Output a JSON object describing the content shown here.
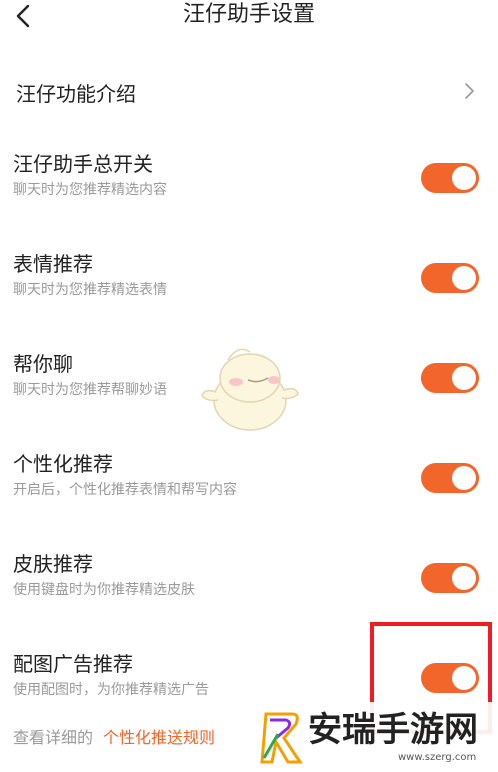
{
  "header": {
    "title": "汪仔助手设置",
    "back_icon": "back-arrow-icon"
  },
  "intro": {
    "label": "汪仔功能介绍",
    "icon": "chevron-right-icon"
  },
  "settings": [
    {
      "label": "汪仔助手总开关",
      "sub": "聊天时为您推荐精选内容",
      "enabled": true
    },
    {
      "label": "表情推荐",
      "sub": "聊天时为您推荐精选表情",
      "enabled": true
    },
    {
      "label": "帮你聊",
      "sub": "聊天时为您推荐帮聊妙语",
      "enabled": true
    },
    {
      "label": "个性化推荐",
      "sub": "开启后，个性化推荐表情和帮写内容",
      "enabled": true
    },
    {
      "label": "皮肤推荐",
      "sub": "使用键盘时为你推荐精选皮肤",
      "enabled": true
    },
    {
      "label": "配图广告推荐",
      "sub": "使用配图时，为你推荐精选广告",
      "enabled": true
    }
  ],
  "footer": {
    "prefix": "查看详细的",
    "link": "个性化推送规则"
  },
  "watermark": {
    "text": "安瑞手游网",
    "url": "www.szerg.com"
  },
  "colors": {
    "accent": "#f2662b",
    "highlight": "#ee1c24",
    "subtext": "#9a9a9a"
  }
}
